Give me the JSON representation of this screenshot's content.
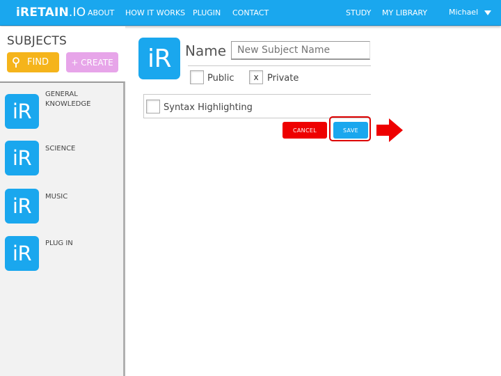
{
  "nav": {
    "brand_bold": "iRETAIN",
    "brand_light": ".IO",
    "links": [
      "ABOUT",
      "HOW IT WORKS",
      "PLUGIN",
      "CONTACT"
    ],
    "right_links": [
      "STUDY",
      "MY LIBRARY"
    ],
    "user": "Michael"
  },
  "sidebar": {
    "heading": "SUBJECTS",
    "find_label": "FIND",
    "create_label": "+ CREATE",
    "logo_text": "iR",
    "items": [
      {
        "label": "GENERAL KNOWLEDGE"
      },
      {
        "label": "SCIENCE"
      },
      {
        "label": "MUSIC"
      },
      {
        "label": "PLUG IN"
      }
    ]
  },
  "form": {
    "logo_text": "iR",
    "name_label": "Name",
    "name_placeholder": "New Subject Name",
    "public_label": "Public",
    "private_label": "Private",
    "private_mark": "x",
    "syntax_label": "Syntax Highlighting",
    "cancel_label": "CANCEL",
    "save_label": "SAVE"
  },
  "colors": {
    "brand_blue": "#1aa7ee",
    "find_yellow": "#f5b41b",
    "create_pink": "#e7a5e9",
    "cancel_red": "#ee0000",
    "highlight_red": "#dd0000"
  },
  "icons": {
    "find": "magnifier-icon",
    "user_menu": "caret-down-icon",
    "annotation": "arrow-left-icon"
  }
}
